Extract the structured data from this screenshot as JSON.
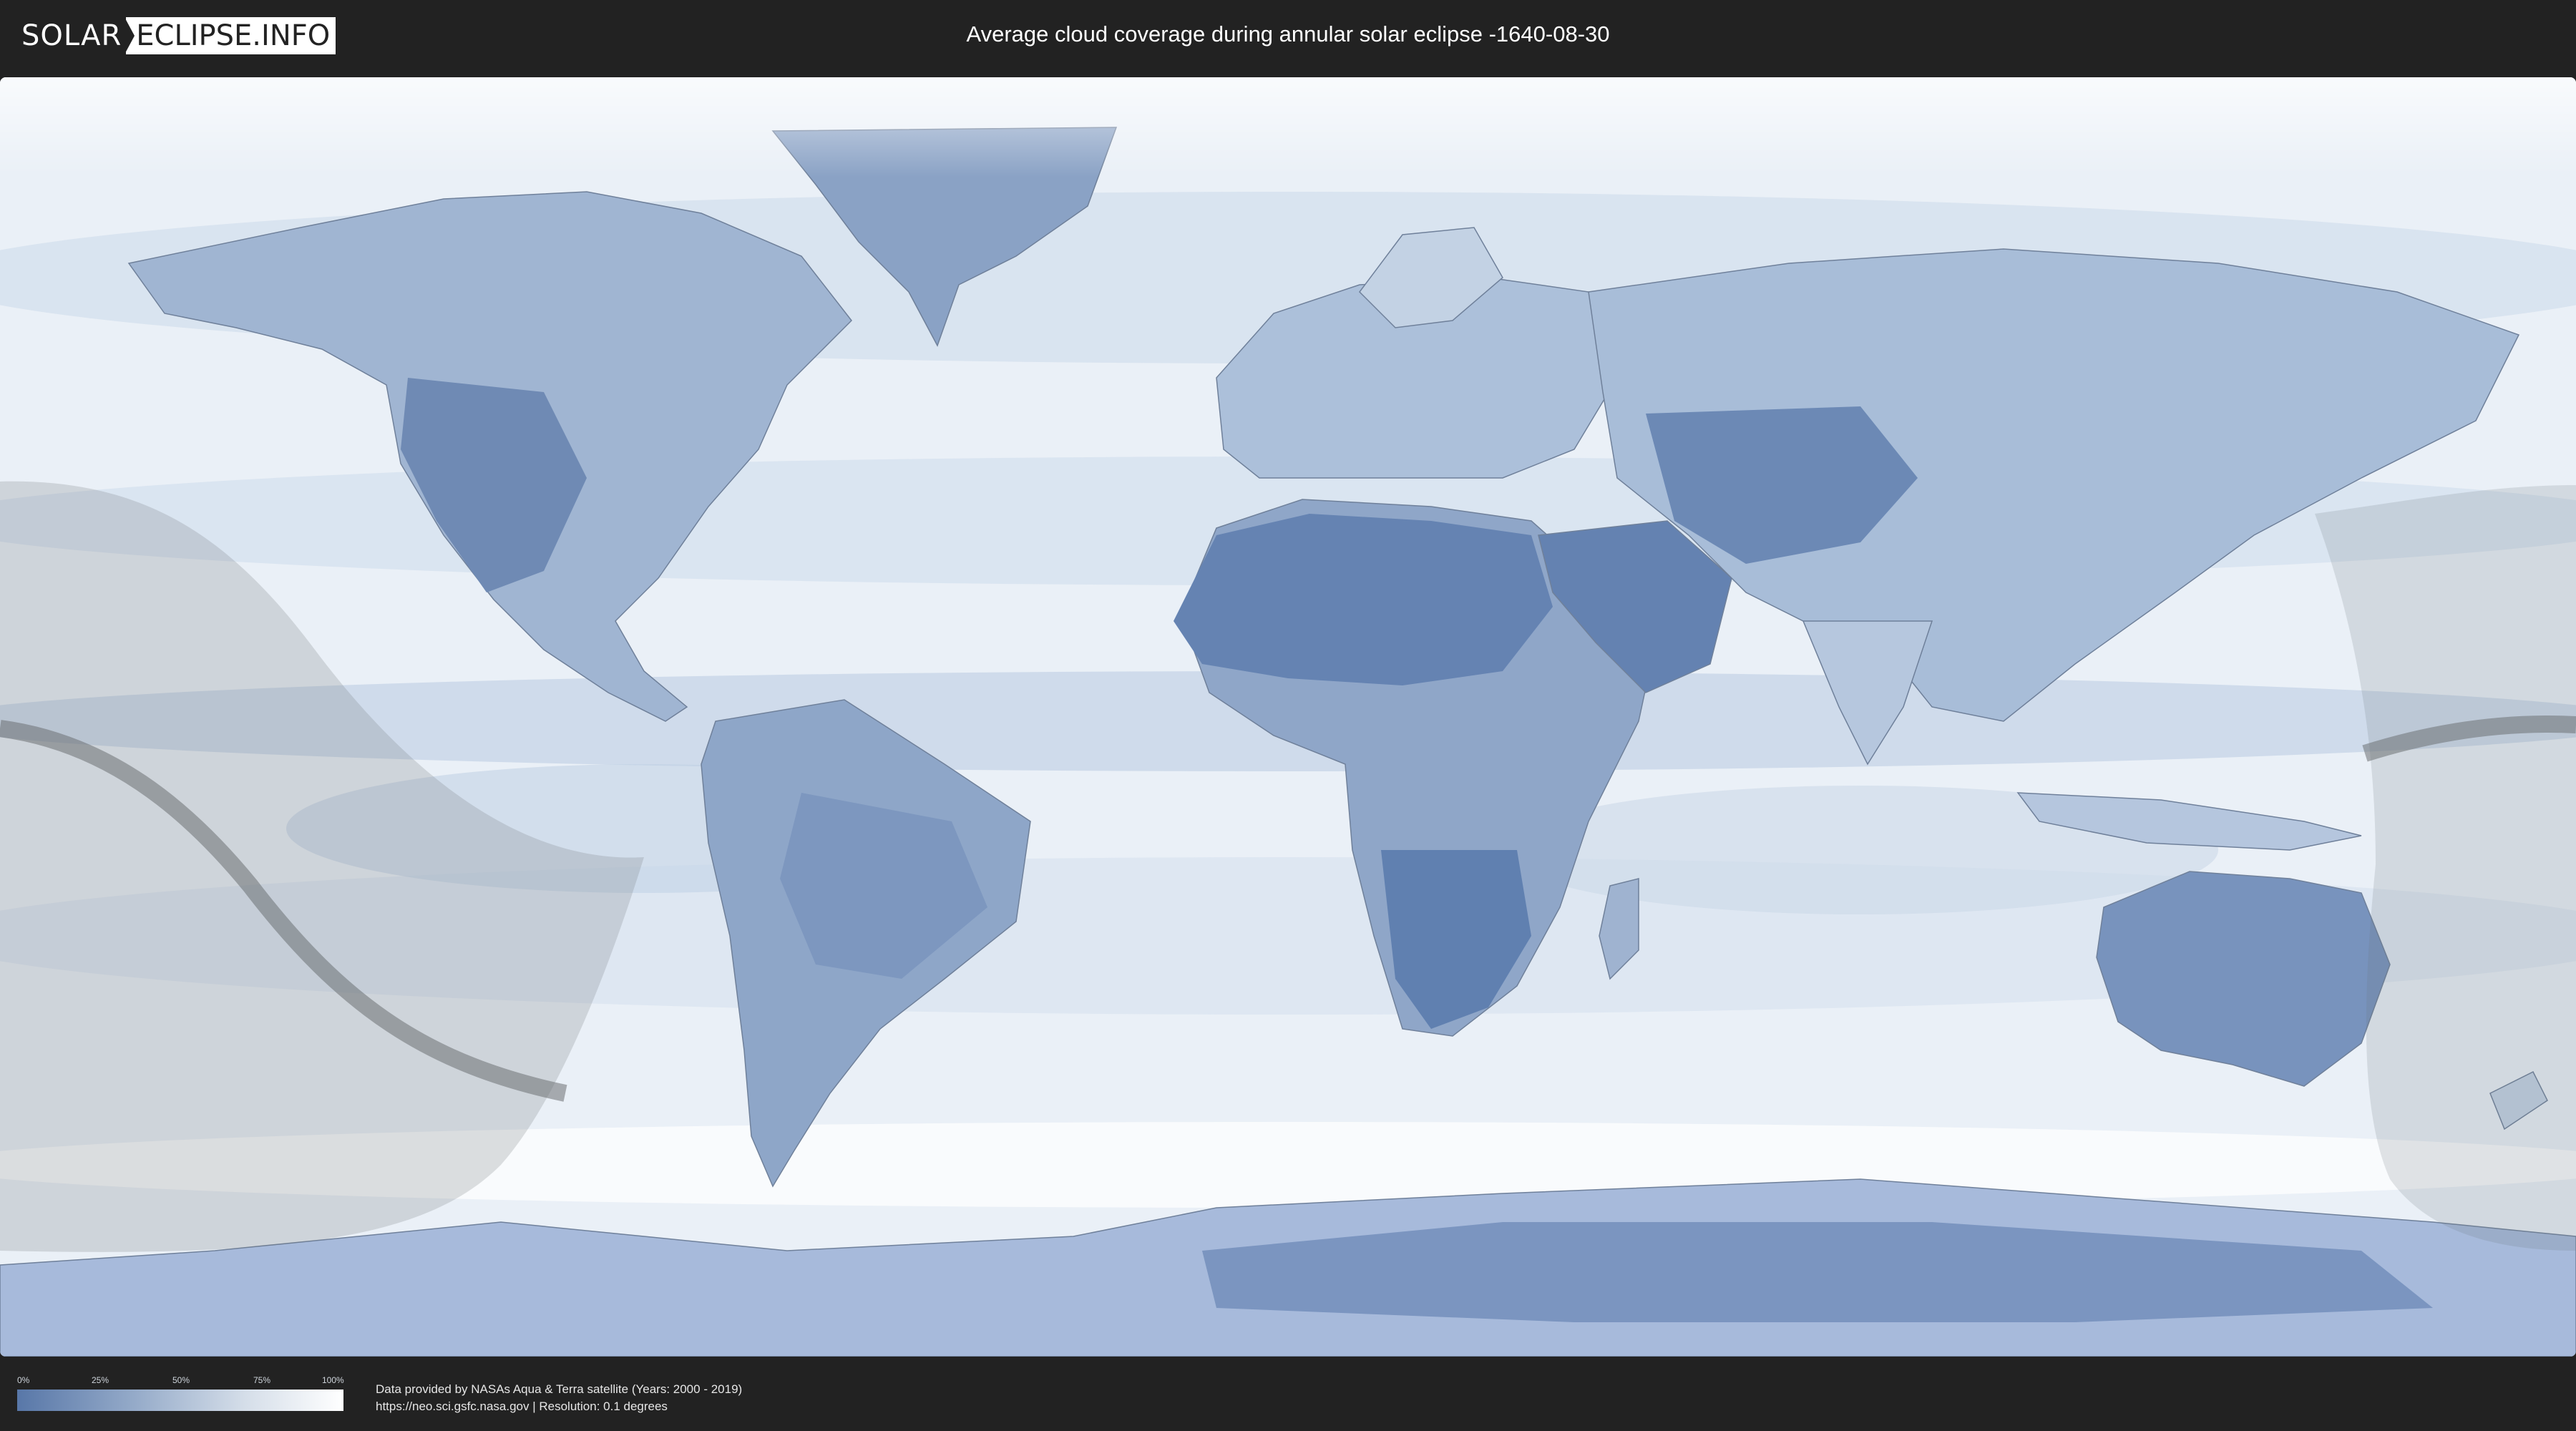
{
  "header": {
    "logo_left": "SOLAR",
    "logo_right": "ECLIPSE.INFO",
    "title": "Average cloud coverage during annular solar eclipse -1640-08-30"
  },
  "map": {
    "type": "cloud-coverage world map (equirectangular)",
    "eclipse_type": "annular",
    "eclipse_date": "-1640-08-30",
    "colors": {
      "clear_sky": "#5877a8",
      "cloudy": "#ffffff",
      "ocean_base": "#eef3f9",
      "eclipse_shadow": "#7f8489",
      "central_line": "#6b6f73"
    }
  },
  "legend": {
    "ticks": [
      "0%",
      "25%",
      "50%",
      "75%",
      "100%"
    ]
  },
  "footer": {
    "credit_line1": "Data provided by NASAs Aqua & Terra satellite (Years: 2000 - 2019)",
    "credit_line2": "https://neo.sci.gsfc.nasa.gov | Resolution: 0.1 degrees"
  }
}
